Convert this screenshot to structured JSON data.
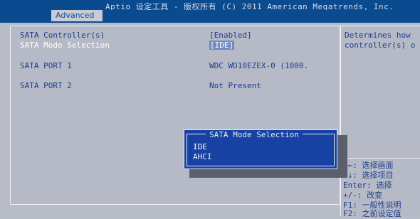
{
  "header": {
    "title": "Aptio 设定工具 - 版权所有 (C) 2011 American Megatrends, Inc."
  },
  "tabs": [
    {
      "label": "Advanced",
      "active": true
    }
  ],
  "settings": [
    {
      "label": "SATA Controller(s)",
      "value": "[Enabled]",
      "selected": false
    },
    {
      "label": "SATA Mode Selection",
      "value": "[IDE]",
      "selected": true
    },
    {
      "label": "SATA PORT 1",
      "value": "WDC WD10EZEX-0 (1000.",
      "selected": false
    },
    {
      "label": "SATA PORT 2",
      "value": "Not Present",
      "selected": false
    }
  ],
  "help": {
    "line1": "Determines how",
    "line2": "controller(s) o",
    "keys": [
      "→←: 选择画面",
      "↑↓: 选择项目",
      "Enter: 选择",
      "+/-: 改变",
      "F1: 一般性说明",
      "F2: 之前设定值"
    ]
  },
  "popup": {
    "title": "SATA Mode Selection",
    "options": [
      "IDE",
      "AHCI"
    ],
    "active_option": "IDE"
  },
  "colors": {
    "background": "#b8bcc7",
    "header": "#0a4a8e",
    "text": "#1b3f8c",
    "popup": "#1741a3"
  }
}
